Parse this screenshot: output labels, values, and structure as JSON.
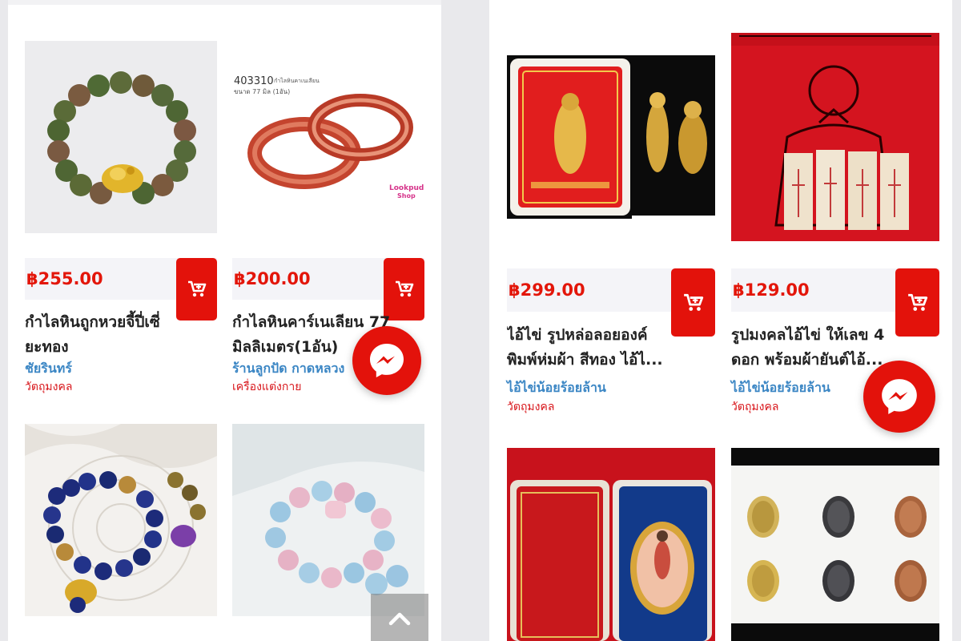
{
  "left_panel": {
    "products": [
      {
        "price": "฿255.00",
        "title": "กำไลหินถูกหวยจี้ปี่เซี่ยะทอง",
        "shop": "ชัยรินทร์",
        "category": "วัตถุมงคล"
      },
      {
        "price": "฿200.00",
        "title": "กำไลหินคาร์เนเลียน 77 มิลลิเมตร(1อัน)",
        "shop": "ร้านลูกปัด กาดหลวง",
        "category": "เครื่องแต่งกาย",
        "image_text": {
          "code": "403310",
          "caption1": "กำไลหินคาเนเลียน",
          "caption2": "ขนาด 77 มิล (1อัน)",
          "logo_line1": "Lookpud",
          "logo_line2": "Shop"
        }
      },
      {
        "price": "",
        "title": "",
        "shop": "",
        "category": ""
      },
      {
        "price": "",
        "title": "",
        "shop": "",
        "category": ""
      }
    ]
  },
  "right_panel": {
    "products": [
      {
        "price": "฿299.00",
        "title": "ไอ้ไข่ รูปหล่อลอยองค์ พิมพ์ห่มผ้า สีทอง ไอ้ไ...",
        "shop": "ไอ้ไข่น้อยร้อยล้าน",
        "category": "วัตถุมงคล"
      },
      {
        "price": "฿129.00",
        "title": "รูปมงคลไอ้ไข่ ให้เลข 4 ดอก พร้อมผ้ายันต์ไอ้...",
        "shop": "ไอ้ไข่น้อยร้อยล้าน",
        "category": "วัตถุมงคล"
      }
    ]
  },
  "icons": {
    "cart": "add-to-cart-icon",
    "messenger": "messenger-icon",
    "scroll_top": "chevron-up-icon"
  },
  "colors": {
    "accent": "#e3120b",
    "price": "#e3160a",
    "shop_link": "#3b86c4",
    "category": "#d8161b"
  }
}
